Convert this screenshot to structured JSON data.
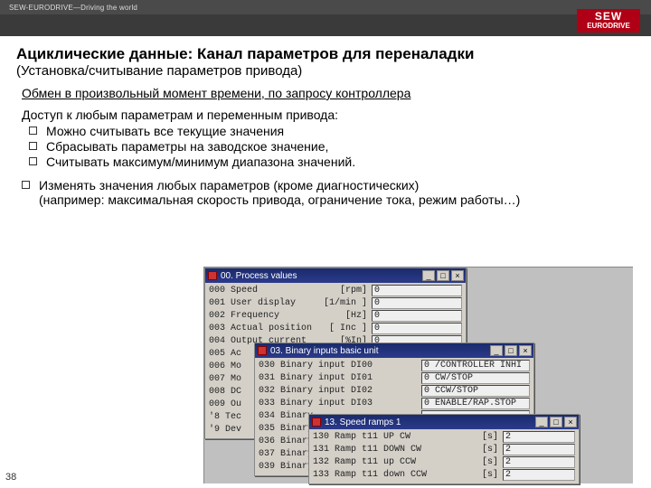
{
  "topbar": "SEW-EURODRIVE—Driving the world",
  "logo": {
    "l1": "SEW",
    "l2": "EURODRIVE"
  },
  "title": "Ациклические данные: Канал параметров для переналадки",
  "subtitle": "(Установка/считывание параметров привода)",
  "underline": "Обмен в произвольный момент времени, по запросу контроллера",
  "lead": "Доступ к любым параметрам и переменным привода:",
  "bullets": [
    "Можно считывать все текущие значения",
    "Сбрасывать параметры на заводское значение,",
    "Считывать максимум/минимум диапазона значений."
  ],
  "bullet2_l1": "Изменять значения любых параметров (кроме диагностических)",
  "bullet2_l2": "(например: максимальная скорость привода, ограничение тока, режим работы…)",
  "pagenum": "38",
  "win1": {
    "title": "00. Process values",
    "rows": [
      {
        "label": "000 Speed",
        "unit": "[rpm]",
        "val": "0"
      },
      {
        "label": "001 User display",
        "unit": "[1/min ]",
        "val": "0"
      },
      {
        "label": "002 Frequency",
        "unit": "[Hz]",
        "val": "0"
      },
      {
        "label": "003 Actual position",
        "unit": "[ Inc ]",
        "val": "0"
      },
      {
        "label": "004 Output current",
        "unit": "[%In]",
        "val": "0"
      },
      {
        "label": "005 Ac",
        "unit": "",
        "val": ""
      },
      {
        "label": "006 Mo",
        "unit": "",
        "val": ""
      },
      {
        "label": "007 Mo",
        "unit": "",
        "val": ""
      },
      {
        "label": "008 DC",
        "unit": "",
        "val": ""
      },
      {
        "label": "009 Ou",
        "unit": "",
        "val": ""
      },
      {
        "label": "'8 Tec",
        "unit": "",
        "val": ""
      },
      {
        "label": "'9 Dev",
        "unit": "",
        "val": ""
      }
    ]
  },
  "win2": {
    "title": "03. Binary inputs basic unit",
    "rows": [
      {
        "label": "030 Binary input DI00",
        "val": "0 /CONTROLLER INHI"
      },
      {
        "label": "031 Binary input DI01",
        "val": "0 CW/STOP"
      },
      {
        "label": "032 Binary input DI02",
        "val": "0 CCW/STOP"
      },
      {
        "label": "033 Binary input DI03",
        "val": "0 ENABLE/RAP.STOP"
      },
      {
        "label": "034 Binary",
        "val": ""
      },
      {
        "label": "035 Binary",
        "val": ""
      },
      {
        "label": "036 Binary",
        "val": ""
      },
      {
        "label": "037 Binary",
        "val": ""
      },
      {
        "label": "039 Binary",
        "val": ""
      }
    ]
  },
  "win3": {
    "title": "13. Speed ramps 1",
    "rows": [
      {
        "label": "130 Ramp t11 UP CW",
        "unit": "[s]",
        "val": "2"
      },
      {
        "label": "131 Ramp t11 DOWN CW",
        "unit": "[s]",
        "val": "2"
      },
      {
        "label": "132 Ramp t11 up CCW",
        "unit": "[s]",
        "val": "2"
      },
      {
        "label": "133 Ramp t11 down CCW",
        "unit": "[s]",
        "val": "2"
      }
    ]
  },
  "winbtns": {
    "min": "_",
    "max": "□",
    "close": "×"
  }
}
